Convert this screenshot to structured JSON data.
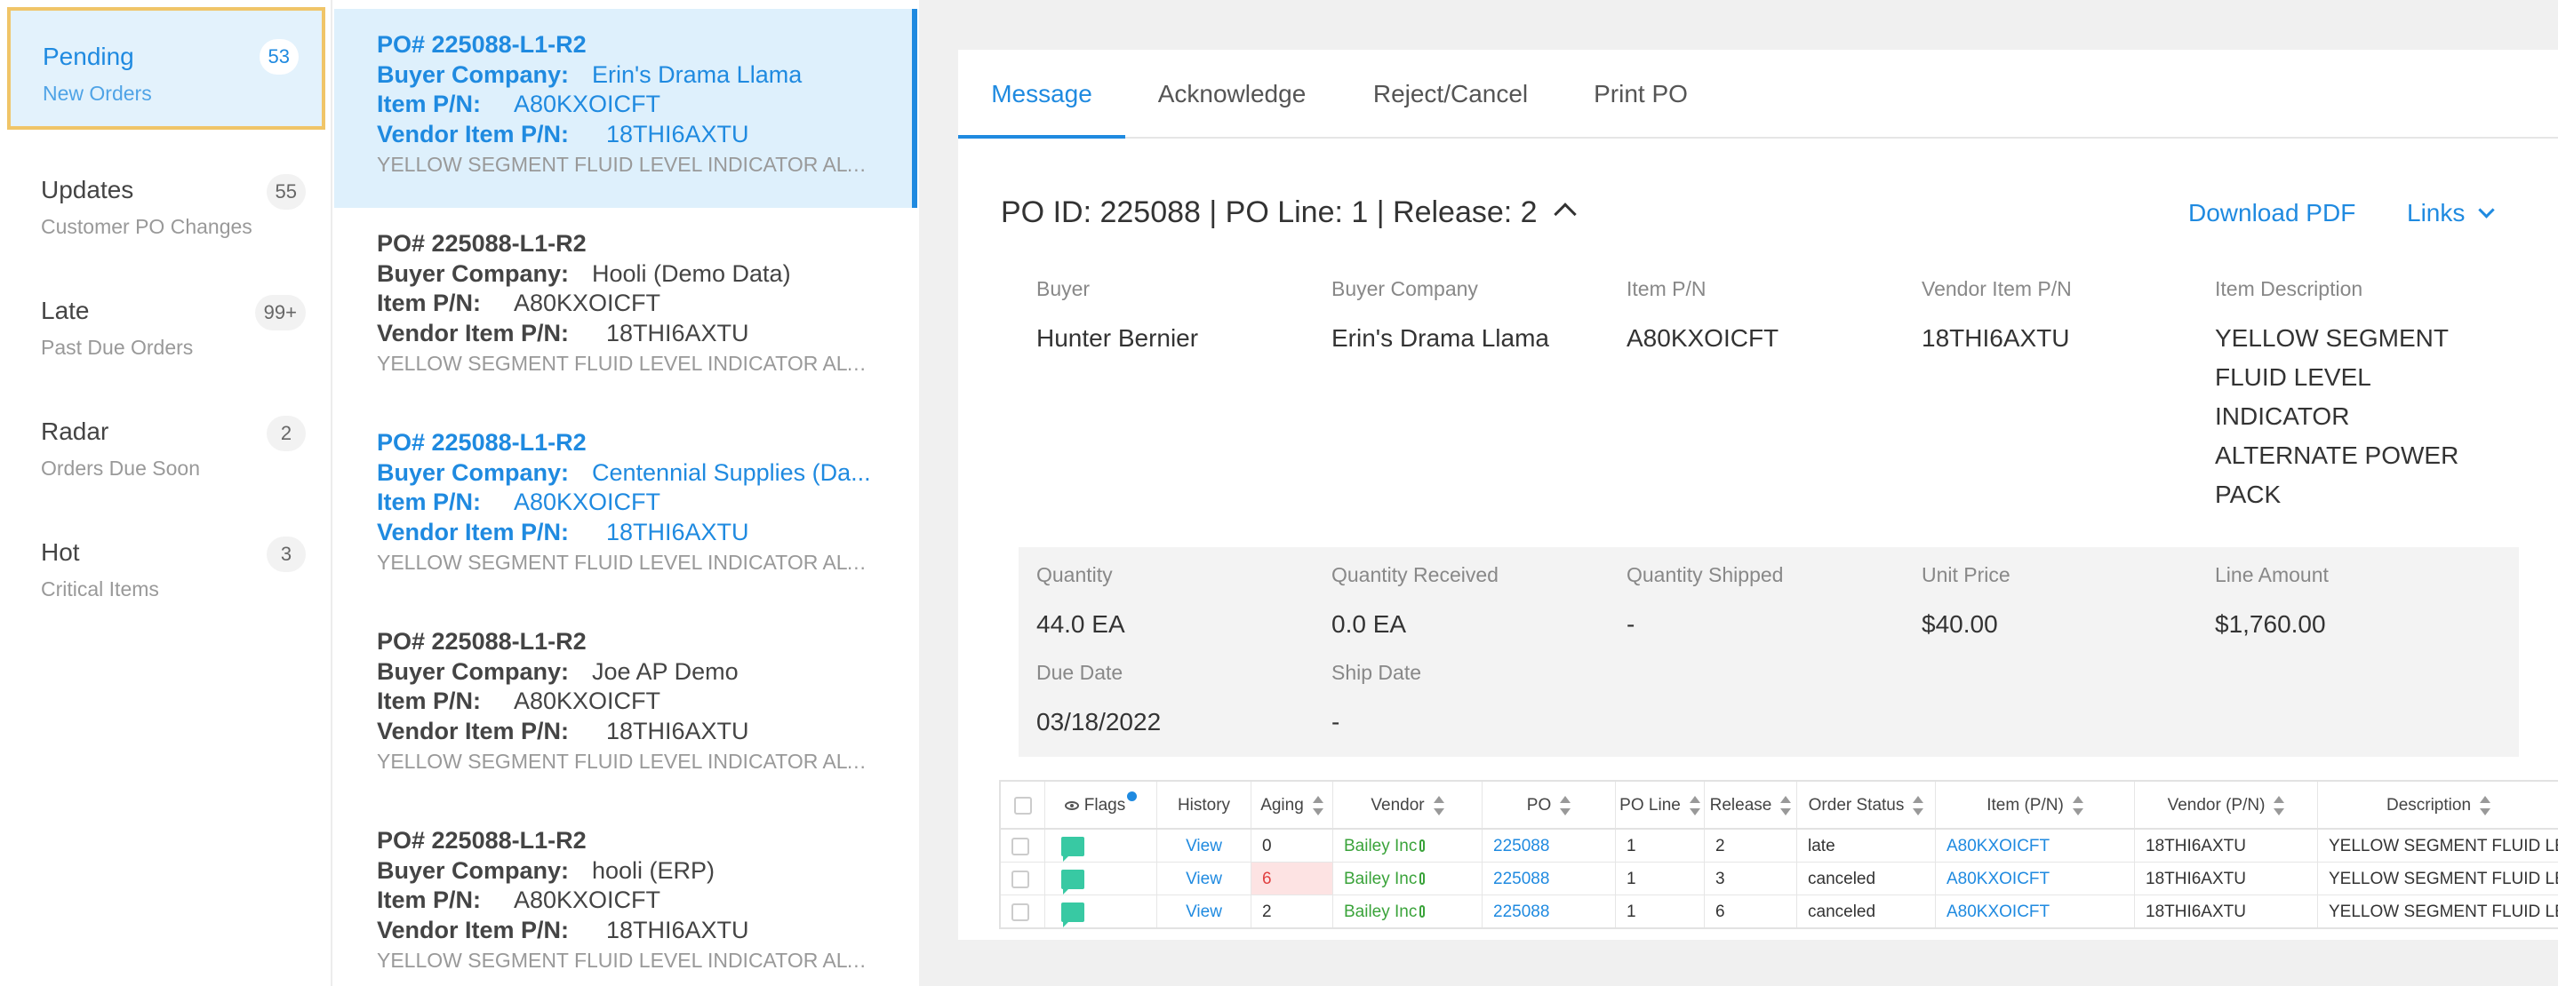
{
  "sidebar": {
    "items": [
      {
        "label": "Pending",
        "sub": "New Orders",
        "count": "53"
      },
      {
        "label": "Updates",
        "sub": "Customer PO Changes",
        "count": "55"
      },
      {
        "label": "Late",
        "sub": "Past Due Orders",
        "count": "99+"
      },
      {
        "label": "Radar",
        "sub": "Orders Due Soon",
        "count": "2"
      },
      {
        "label": "Hot",
        "sub": "Critical Items",
        "count": "3"
      }
    ]
  },
  "orders": {
    "labels": {
      "buyer_company": "Buyer Company:",
      "item_pn": "Item P/N:",
      "vendor_item_pn": "Vendor Item P/N:"
    },
    "items": [
      {
        "po": "PO# 225088-L1-R2",
        "buyer_company": "Erin's Drama Llama",
        "item_pn": "A80KXOICFT",
        "vendor_item_pn": "18THI6AXTU",
        "description": "YELLOW SEGMENT FLUID LEVEL INDICATOR ALTER..."
      },
      {
        "po": "PO# 225088-L1-R2",
        "buyer_company": "Hooli (Demo Data)",
        "item_pn": "A80KXOICFT",
        "vendor_item_pn": "18THI6AXTU",
        "description": "YELLOW SEGMENT FLUID LEVEL INDICATOR ALTER..."
      },
      {
        "po": "PO# 225088-L1-R2",
        "buyer_company": "Centennial Supplies (Da...",
        "item_pn": "A80KXOICFT",
        "vendor_item_pn": "18THI6AXTU",
        "description": "YELLOW SEGMENT FLUID LEVEL INDICATOR ALTER..."
      },
      {
        "po": "PO# 225088-L1-R2",
        "buyer_company": "Joe AP Demo",
        "item_pn": "A80KXOICFT",
        "vendor_item_pn": "18THI6AXTU",
        "description": "YELLOW SEGMENT FLUID LEVEL INDICATOR ALTER..."
      },
      {
        "po": "PO# 225088-L1-R2",
        "buyer_company": "hooli (ERP)",
        "item_pn": "A80KXOICFT",
        "vendor_item_pn": "18THI6AXTU",
        "description": "YELLOW SEGMENT FLUID LEVEL INDICATOR ALTER..."
      }
    ]
  },
  "tabs": [
    "Message",
    "Acknowledge",
    "Reject/Cancel",
    "Print PO"
  ],
  "detail": {
    "header": "PO ID: 225088 | PO Line: 1 | Release: 2",
    "download_pdf": "Download PDF",
    "links": "Links",
    "fields": {
      "buyer": {
        "label": "Buyer",
        "value": "Hunter Bernier"
      },
      "buyer_company": {
        "label": "Buyer Company",
        "value": "Erin's Drama Llama"
      },
      "item_pn": {
        "label": "Item P/N",
        "value": "A80KXOICFT"
      },
      "vendor_item_pn": {
        "label": "Vendor Item P/N",
        "value": "18THI6AXTU"
      },
      "item_description": {
        "label": "Item Description",
        "value": "YELLOW SEGMENT FLUID LEVEL INDICATOR ALTERNATE POWER PACK"
      },
      "quantity": {
        "label": "Quantity",
        "value": "44.0 EA"
      },
      "quantity_received": {
        "label": "Quantity Received",
        "value": "0.0 EA"
      },
      "quantity_shipped": {
        "label": "Quantity Shipped",
        "value": "-"
      },
      "unit_price": {
        "label": "Unit Price",
        "value": "$40.00"
      },
      "line_amount": {
        "label": "Line Amount",
        "value": "$1,760.00"
      },
      "due_date": {
        "label": "Due Date",
        "value": "03/18/2022"
      },
      "ship_date": {
        "label": "Ship Date",
        "value": "-"
      }
    }
  },
  "grid": {
    "columns": [
      "Flags",
      "History",
      "Aging",
      "Vendor",
      "PO",
      "PO Line",
      "Release",
      "Order Status",
      "Item (P/N)",
      "Vendor (P/N)",
      "Description"
    ],
    "rows": [
      {
        "history": "View",
        "aging": "0",
        "vendor": "Bailey Inc",
        "po": "225088",
        "po_line": "1",
        "release": "2",
        "status": "late",
        "item_pn": "A80KXOICFT",
        "vendor_pn": "18THI6AXTU",
        "description": "YELLOW SEGMENT FLUID LE..."
      },
      {
        "history": "View",
        "aging": "6",
        "vendor": "Bailey Inc",
        "po": "225088",
        "po_line": "1",
        "release": "3",
        "status": "canceled",
        "item_pn": "A80KXOICFT",
        "vendor_pn": "18THI6AXTU",
        "description": "YELLOW SEGMENT FLUID LE..."
      },
      {
        "history": "View",
        "aging": "2",
        "vendor": "Bailey Inc",
        "po": "225088",
        "po_line": "1",
        "release": "6",
        "status": "canceled",
        "item_pn": "A80KXOICFT",
        "vendor_pn": "18THI6AXTU",
        "description": "YELLOW SEGMENT FLUID LE..."
      }
    ]
  },
  "colors": {
    "accent": "#1f8ae0",
    "highlight_border": "#f0c568",
    "selected_bg": "#def0fc",
    "flag": "#38c9a3",
    "vendor_link": "#3aa33a",
    "late_aging": "#e04040"
  }
}
